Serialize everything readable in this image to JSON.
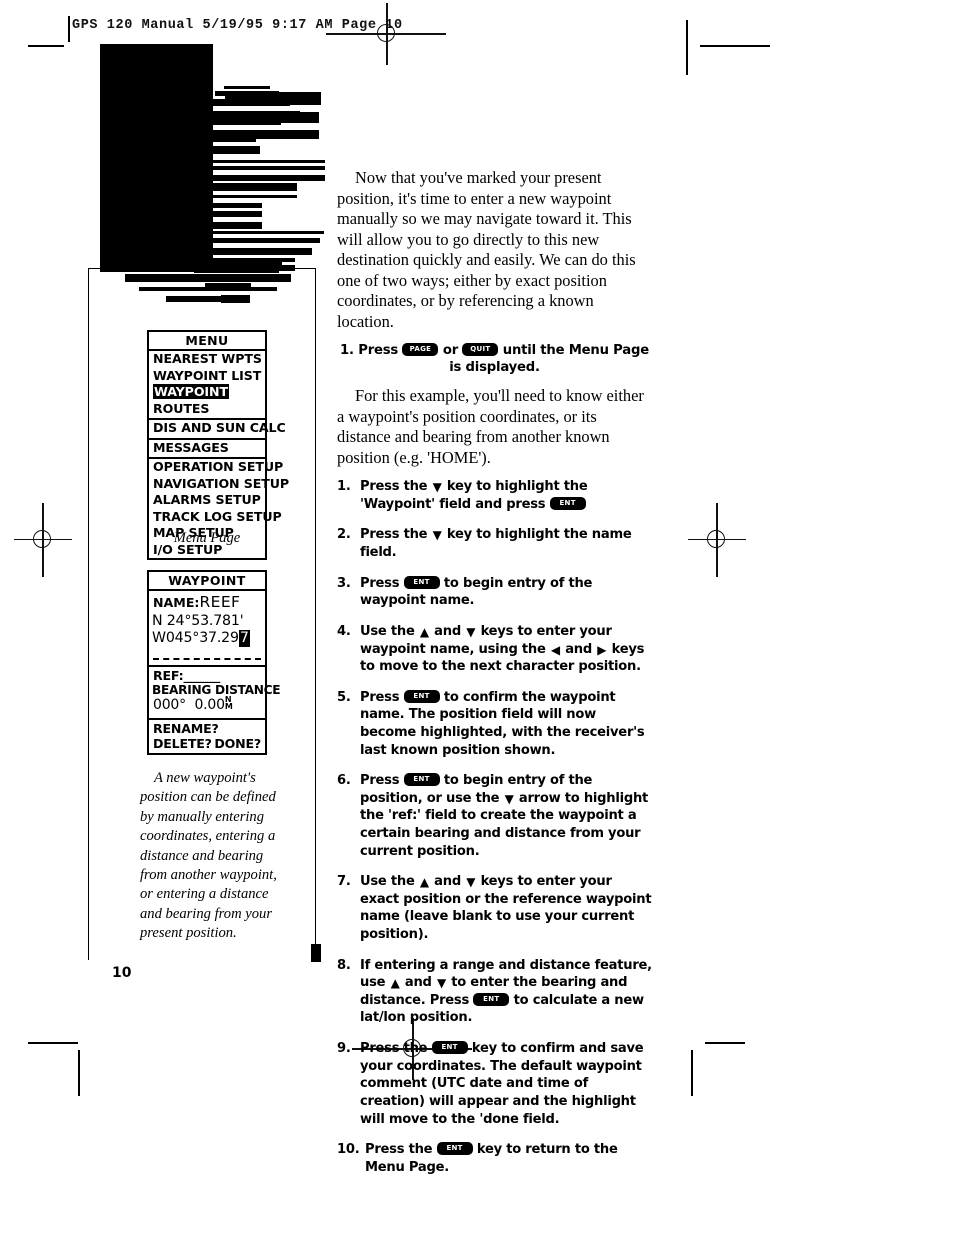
{
  "print_header": "GPS 120 Manual  5/19/95 9:17 AM  Page 10",
  "chapter_tab": {
    "title_line1": "Getting",
    "title_line2": "Started",
    "subtitle_line1": "Entering a",
    "subtitle_line2": "Waypoint"
  },
  "page_number": "10",
  "menu_screen": {
    "title": "MENU",
    "items": [
      {
        "label": "NEAREST WPTS",
        "selected": false,
        "divider": false
      },
      {
        "label": "WAYPOINT LIST",
        "selected": false,
        "divider": false
      },
      {
        "label": "WAYPOINT",
        "selected": true,
        "divider": false
      },
      {
        "label": "ROUTES",
        "selected": false,
        "divider": true
      },
      {
        "label": "DIS AND SUN CALC",
        "selected": false,
        "divider": true
      },
      {
        "label": "MESSAGES",
        "selected": false,
        "divider": true
      },
      {
        "label": "OPERATION SETUP",
        "selected": false,
        "divider": false
      },
      {
        "label": "NAVIGATION SETUP",
        "selected": false,
        "divider": false
      },
      {
        "label": "ALARMS SETUP",
        "selected": false,
        "divider": false
      },
      {
        "label": "TRACK LOG SETUP",
        "selected": false,
        "divider": false
      },
      {
        "label": "MAP SETUP",
        "selected": false,
        "divider": false
      },
      {
        "label": "I/O SETUP",
        "selected": false,
        "divider": false
      }
    ],
    "caption": "Menu Page"
  },
  "waypoint_screen": {
    "title": "WAYPOINT",
    "name_label": "NAME:",
    "name_value": "REEF",
    "lat": "N 24°53.781'",
    "lon_prefix": "W045°37.29",
    "lon_cursor": "7",
    "ref_label": "REF:",
    "ref_value": "______",
    "bearing_header": "BEARING",
    "distance_header": "DISTANCE",
    "bearing_value": "000°",
    "distance_value": "0.00",
    "distance_unit_top": "N",
    "distance_unit_bottom": "M",
    "rename_label": "RENAME?",
    "delete_label": "DELETE?",
    "done_label": "DONE?",
    "caption": "A new waypoint's position can be defined by manually entering coordinates, entering a distance and bearing from another waypoint, or entering a distance and bearing from your present position."
  },
  "body": {
    "para1": "Now that you've marked your present position, it's time to enter a new waypoint manually so we may navigate toward it. This will allow you to go directly to this new destination quickly and easily. We can do this one of two ways; either by exact position coordinates, or by referencing a known location.",
    "step_lead": {
      "num": "1. ",
      "text_a": "Press ",
      "key1": "PAGE",
      "text_b": " or ",
      "key2": "QUIT",
      "text_c": " until the Menu Page is displayed."
    },
    "para2": "For this example, you'll need to know either a waypoint's position coordinates, or its distance and bearing from another known position (e.g. 'HOME')."
  },
  "steps": [
    {
      "num": "1.",
      "parts": [
        {
          "t": "text",
          "v": "Press the "
        },
        {
          "t": "arrow",
          "v": "▼"
        },
        {
          "t": "text",
          "v": " key to highlight the 'Waypoint' field and press "
        },
        {
          "t": "key",
          "v": "ENT"
        }
      ]
    },
    {
      "num": "2.",
      "parts": [
        {
          "t": "text",
          "v": "Press the "
        },
        {
          "t": "arrow",
          "v": "▼"
        },
        {
          "t": "text",
          "v": " key to highlight the name field."
        }
      ]
    },
    {
      "num": "3.",
      "parts": [
        {
          "t": "text",
          "v": "Press "
        },
        {
          "t": "key",
          "v": "ENT"
        },
        {
          "t": "text",
          "v": " to begin entry of the waypoint name."
        }
      ]
    },
    {
      "num": "4.",
      "parts": [
        {
          "t": "text",
          "v": "Use the "
        },
        {
          "t": "arrow",
          "v": "▲"
        },
        {
          "t": "text",
          "v": " and "
        },
        {
          "t": "arrow",
          "v": "▼"
        },
        {
          "t": "text",
          "v": " keys to enter your waypoint name, using the "
        },
        {
          "t": "arrow",
          "v": "◀"
        },
        {
          "t": "text",
          "v": " and "
        },
        {
          "t": "arrow",
          "v": "▶"
        },
        {
          "t": "text",
          "v": " keys to move to the next character position."
        }
      ]
    },
    {
      "num": "5.",
      "parts": [
        {
          "t": "text",
          "v": "Press "
        },
        {
          "t": "key",
          "v": "ENT"
        },
        {
          "t": "text",
          "v": " to confirm the waypoint name. The position field will now become highlighted, with the receiver's last known position shown."
        }
      ]
    },
    {
      "num": "6.",
      "parts": [
        {
          "t": "text",
          "v": "Press "
        },
        {
          "t": "key",
          "v": "ENT"
        },
        {
          "t": "text",
          "v": " to begin entry of the position, or use the "
        },
        {
          "t": "arrow",
          "v": "▼"
        },
        {
          "t": "text",
          "v": " arrow to highlight the 'ref:' field to create the  waypoint a certain bearing and distance from your current position."
        }
      ]
    },
    {
      "num": "7.",
      "parts": [
        {
          "t": "text",
          "v": "Use the "
        },
        {
          "t": "arrow",
          "v": "▲"
        },
        {
          "t": "text",
          "v": " and "
        },
        {
          "t": "arrow",
          "v": "▼"
        },
        {
          "t": "text",
          "v": " keys to enter your exact position or the reference waypoint name (leave blank to use your current position)."
        }
      ]
    },
    {
      "num": "8.",
      "parts": [
        {
          "t": "text",
          "v": "If entering a range and distance feature, use "
        },
        {
          "t": "arrow",
          "v": "▲"
        },
        {
          "t": "text",
          "v": " and "
        },
        {
          "t": "arrow",
          "v": "▼"
        },
        {
          "t": "text",
          "v": " to enter the bearing and distance. Press "
        },
        {
          "t": "key",
          "v": "ENT"
        },
        {
          "t": "text",
          "v": " to calculate a new lat/lon position."
        }
      ]
    },
    {
      "num": "9.",
      "parts": [
        {
          "t": "text",
          "v": "Press the "
        },
        {
          "t": "key",
          "v": "ENT"
        },
        {
          "t": "text",
          "v": " key to confirm and save your coordinates. The default waypoint comment (UTC date and time of creation) will appear and the highlight will move to the 'done field."
        }
      ]
    },
    {
      "num": "10.",
      "wide": true,
      "parts": [
        {
          "t": "text",
          "v": "Press the "
        },
        {
          "t": "key",
          "v": "ENT"
        },
        {
          "t": "text",
          "v": " key to return to the Menu Page."
        }
      ]
    }
  ]
}
